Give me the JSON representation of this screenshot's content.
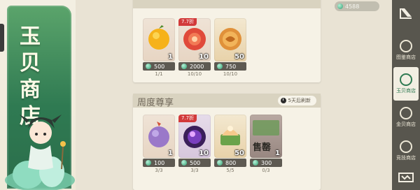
{
  "banner": {
    "title_chars": [
      "玉",
      "贝",
      "商",
      "店"
    ]
  },
  "currency": {
    "amount": "4588"
  },
  "panel_top": {
    "items": [
      {
        "qty": "1",
        "price": "500",
        "stock": "1/1",
        "fruit": "orange"
      },
      {
        "qty": "10",
        "price": "2000",
        "stock": "10/10",
        "fruit": "red-pomegranate",
        "discount": "7.7折"
      },
      {
        "qty": "50",
        "price": "750",
        "stock": "10/10",
        "fruit": "gold-coin"
      }
    ]
  },
  "panel_weekly": {
    "title": "周度尊享",
    "refresh": "5天后刷新",
    "items": [
      {
        "qty": "1",
        "price": "100",
        "stock": "3/3",
        "fruit": "purple-fruit"
      },
      {
        "qty": "10",
        "price": "500",
        "stock": "3/3",
        "fruit": "purple-orb",
        "discount": "7.7折"
      },
      {
        "qty": "50",
        "price": "800",
        "stock": "5/5",
        "fruit": "cake"
      },
      {
        "qty": "1",
        "price": "300",
        "stock": "0/3",
        "fruit": "sold-item",
        "sold_label": "售罄"
      }
    ]
  },
  "sidebar": {
    "items": [
      {
        "label": "图鉴商店"
      },
      {
        "label": "玉贝商店"
      },
      {
        "label": "金贝商店"
      },
      {
        "label": "竞技商店"
      }
    ]
  },
  "colors": {
    "banner_green": "#2f7a52",
    "discount_red": "#d23a3a",
    "sidebar_bg": "#58564e"
  }
}
